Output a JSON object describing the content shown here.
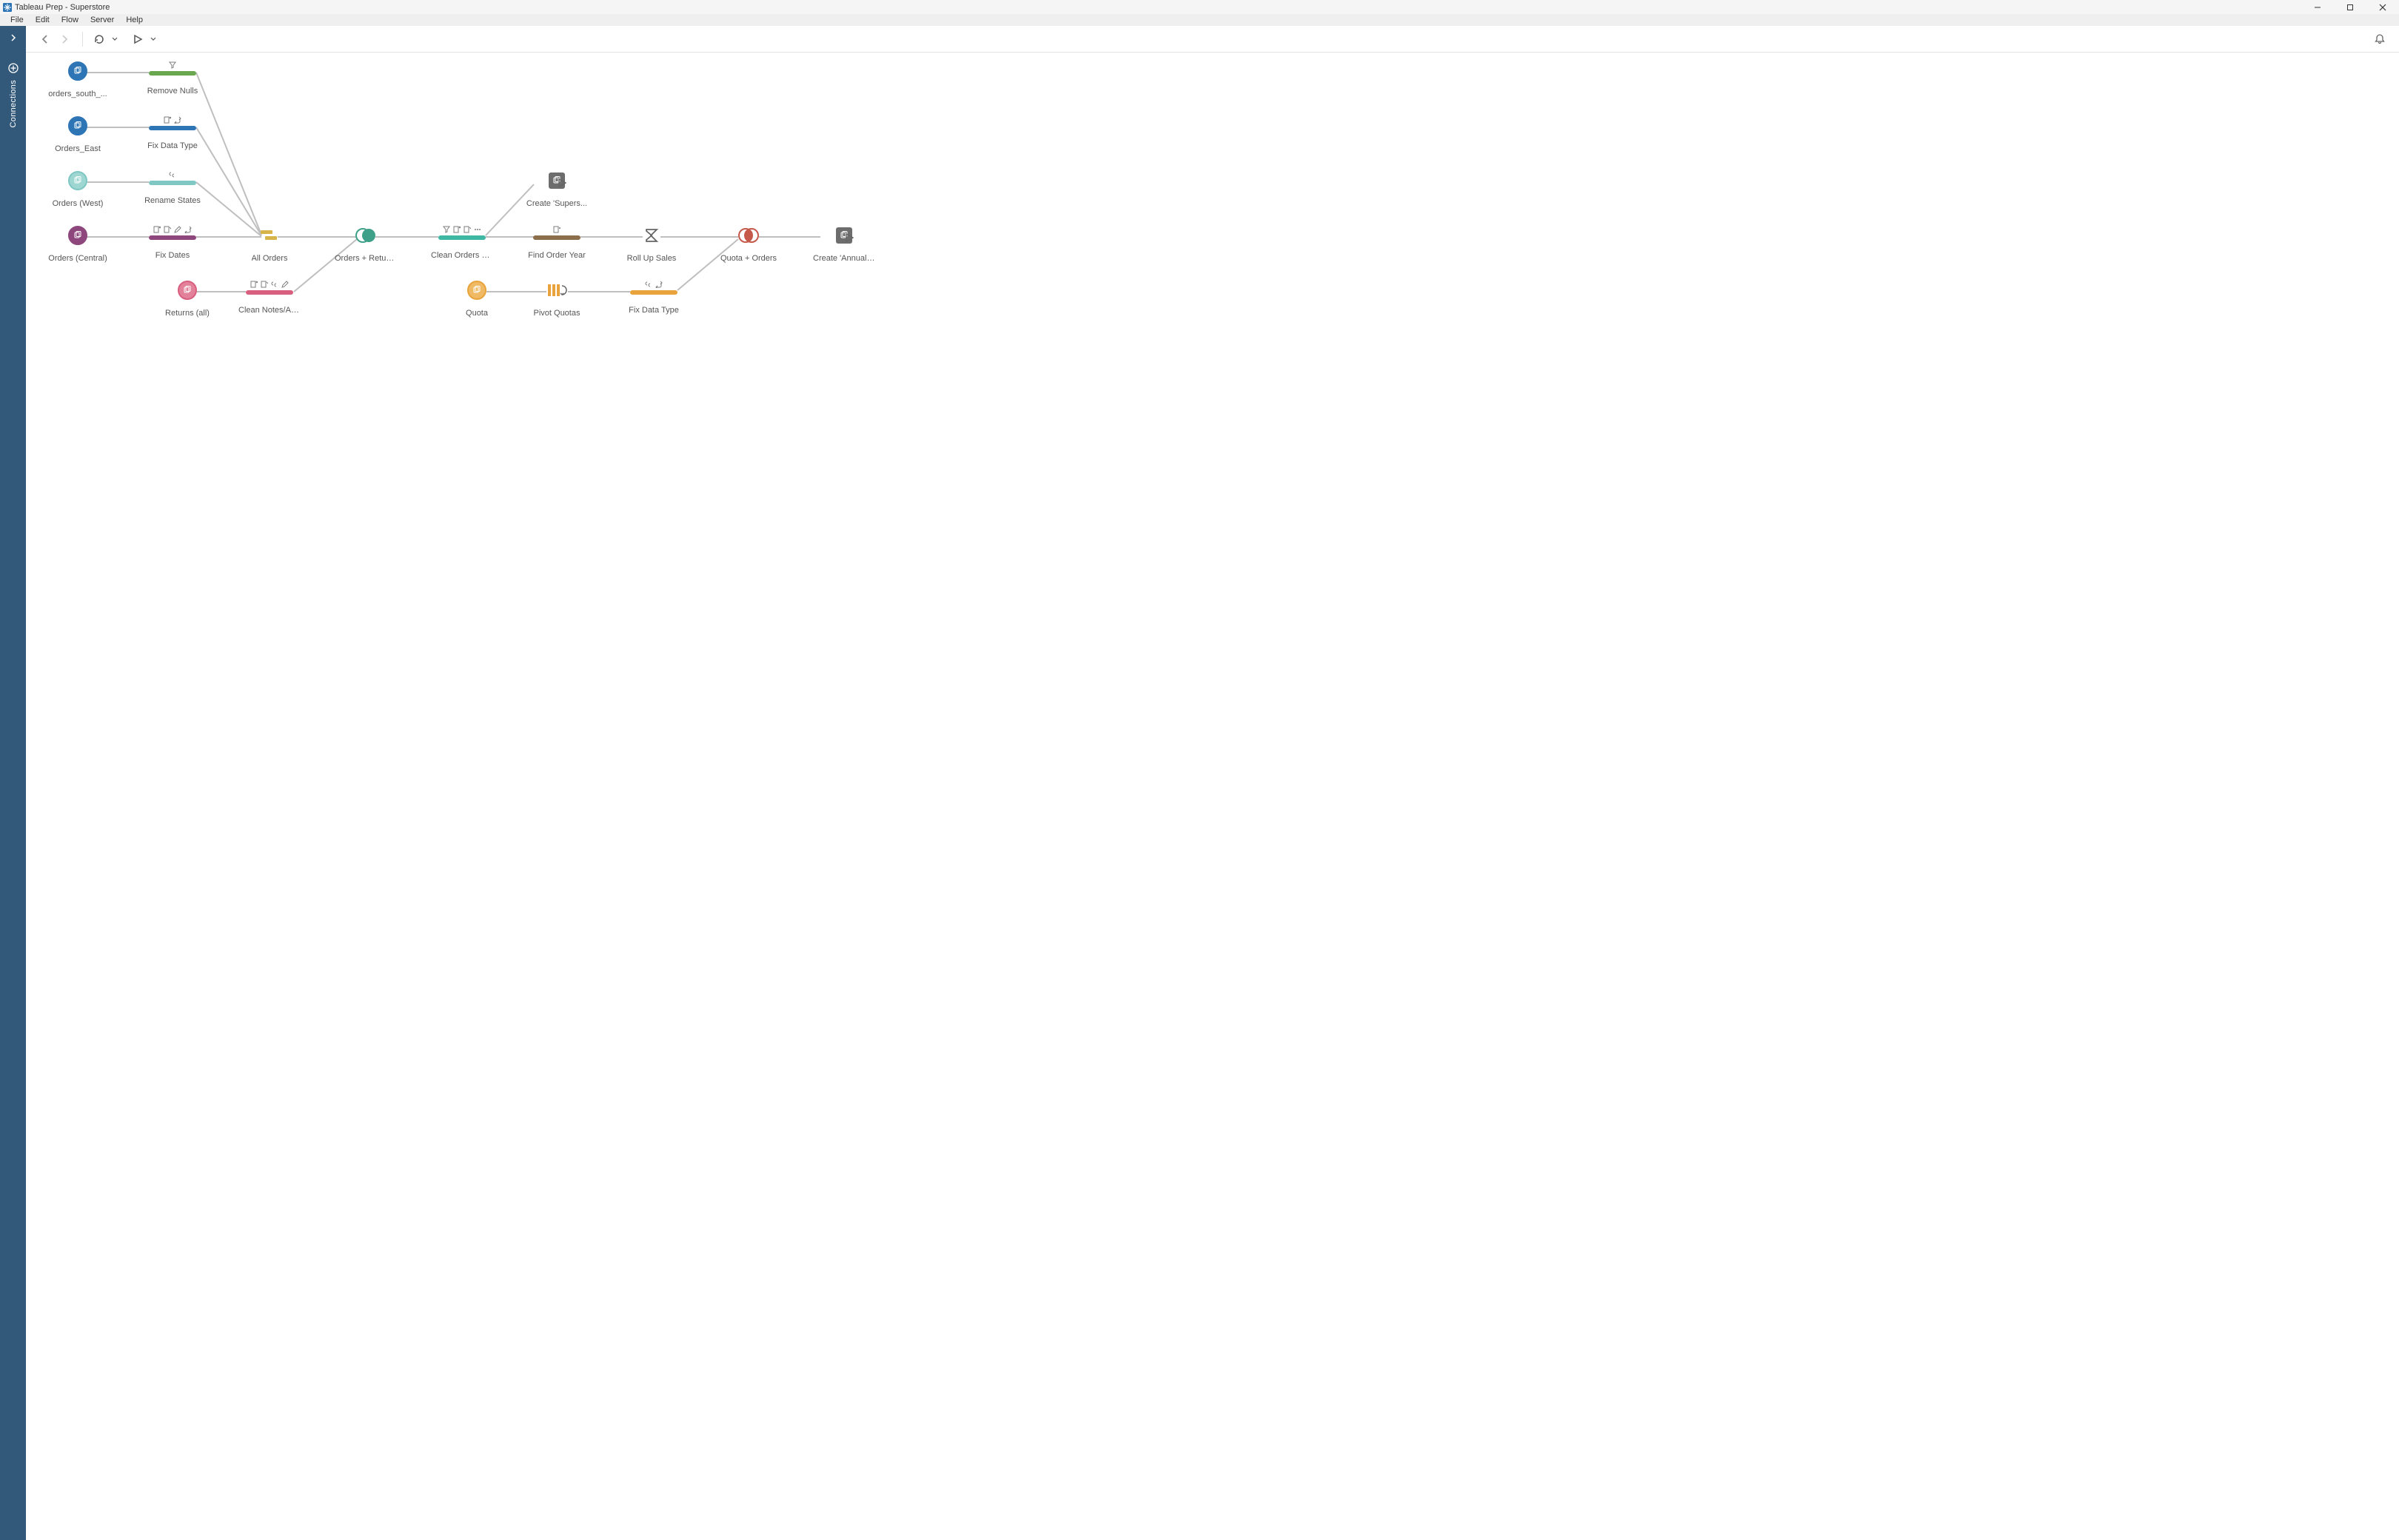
{
  "window": {
    "title": "Tableau Prep - Superstore"
  },
  "menu": {
    "items": [
      "File",
      "Edit",
      "Flow",
      "Server",
      "Help"
    ]
  },
  "leftbar": {
    "label": "Connections"
  },
  "toolbar": {
    "back": "Back",
    "forward": "Forward",
    "refresh": "Refresh",
    "run": "Run Flow",
    "alerts": "Alerts"
  },
  "colors": {
    "green": "#6AA84F",
    "blue": "#2E75B6",
    "teal": "#7FC7C3",
    "plum": "#8E477D",
    "pink": "#D85F7F",
    "teal2": "#3EB7A3",
    "brown": "#8C6E4A",
    "orange": "#E8A33D",
    "orange2": "#E8A33D",
    "ocher": "#D7B44A",
    "joingreen": "#3EA089",
    "sigma": "#666666",
    "joinred": "#C5594A",
    "outputbg": "#666666",
    "leftbar": "#33597a"
  },
  "nodes": {
    "orders_south": {
      "label": "orders_south_..."
    },
    "orders_east": {
      "label": "Orders_East"
    },
    "orders_west": {
      "label": "Orders (West)"
    },
    "orders_central": {
      "label": "Orders (Central)"
    },
    "returns_all": {
      "label": "Returns (all)"
    },
    "remove_nulls": {
      "label": "Remove Nulls"
    },
    "fix_dt_east": {
      "label": "Fix Data Type"
    },
    "rename_states": {
      "label": "Rename States"
    },
    "fix_dates": {
      "label": "Fix Dates"
    },
    "clean_notes": {
      "label": "Clean Notes/Ap..."
    },
    "all_orders": {
      "label": "All Orders"
    },
    "orders_returns": {
      "label": "Orders + Returns"
    },
    "clean_or": {
      "label": "Clean Orders + ..."
    },
    "find_year": {
      "label": "Find Order Year"
    },
    "rollup": {
      "label": "Roll Up Sales"
    },
    "quota": {
      "label": "Quota"
    },
    "pivot_quotas": {
      "label": "Pivot Quotas"
    },
    "fix_dt_quota": {
      "label": "Fix Data Type"
    },
    "quota_orders": {
      "label": "Quota + Orders"
    },
    "out_supers": {
      "label": "Create 'Supers..."
    },
    "out_annual": {
      "label": "Create 'Annual ..."
    }
  }
}
